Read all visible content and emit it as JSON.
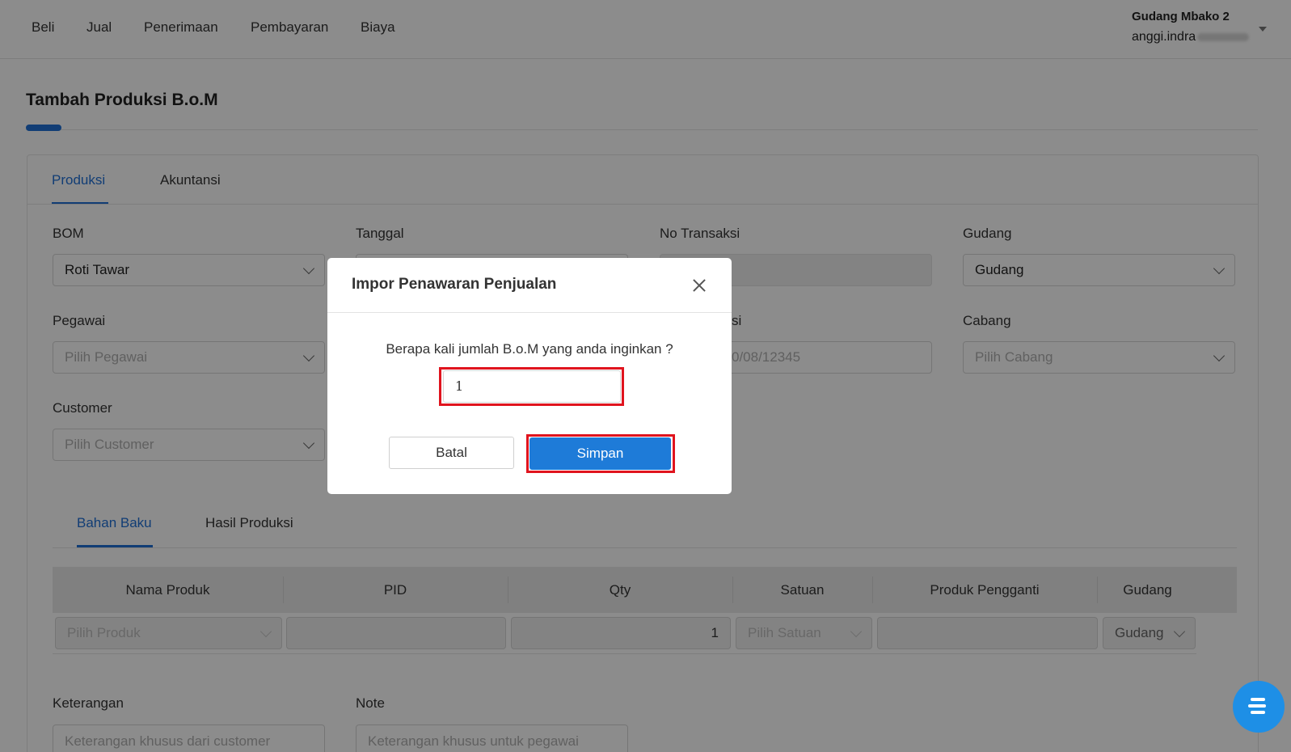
{
  "nav": {
    "items": [
      "Beli",
      "Jual",
      "Penerimaan",
      "Pembayaran",
      "Biaya"
    ]
  },
  "user": {
    "company": "Gudang Mbako 2",
    "email_visible": "anggi.indra"
  },
  "page": {
    "title": "Tambah Produksi B.o.M"
  },
  "tabs": {
    "produksi": "Produksi",
    "akuntansi": "Akuntansi"
  },
  "form": {
    "bom": {
      "label": "BOM",
      "value": "Roti Tawar"
    },
    "tanggal": {
      "label": "Tanggal"
    },
    "no_transaksi": {
      "label": "No Transaksi"
    },
    "gudang": {
      "label": "Gudang",
      "value": "Gudang"
    },
    "pegawai": {
      "label": "Pegawai",
      "placeholder": "Pilih Pegawai"
    },
    "referensi": {
      "label_visible": "si",
      "placeholder_visible": "0/08/12345"
    },
    "cabang": {
      "label": "Cabang",
      "placeholder": "Pilih Cabang"
    },
    "customer": {
      "label": "Customer",
      "placeholder": "Pilih Customer"
    }
  },
  "subtabs": {
    "bahan_baku": "Bahan Baku",
    "hasil_produksi": "Hasil Produksi"
  },
  "table": {
    "columns": [
      "Nama Produk",
      "PID",
      "Qty",
      "Satuan",
      "Produk Pengganti",
      "Gudang"
    ],
    "row": {
      "produk": "Pilih Produk",
      "pid": "",
      "qty": "1",
      "satuan": "Pilih Satuan",
      "pengganti": "",
      "gudang": "Gudang"
    }
  },
  "notes": {
    "keterangan": {
      "label": "Keterangan",
      "placeholder": "Keterangan khusus dari customer"
    },
    "note": {
      "label": "Note",
      "placeholder": "Keterangan khusus untuk pegawai"
    }
  },
  "modal": {
    "title": "Impor Penawaran Penjualan",
    "question": "Berapa kali jumlah B.o.M yang anda inginkan ?",
    "qty_value": "1",
    "cancel_label": "Batal",
    "save_label": "Simpan"
  },
  "colors": {
    "accent": "#1f6fd6",
    "primary_button": "#1e7bd8",
    "highlight": "#e0141e",
    "chat": "#1e8fe6"
  }
}
